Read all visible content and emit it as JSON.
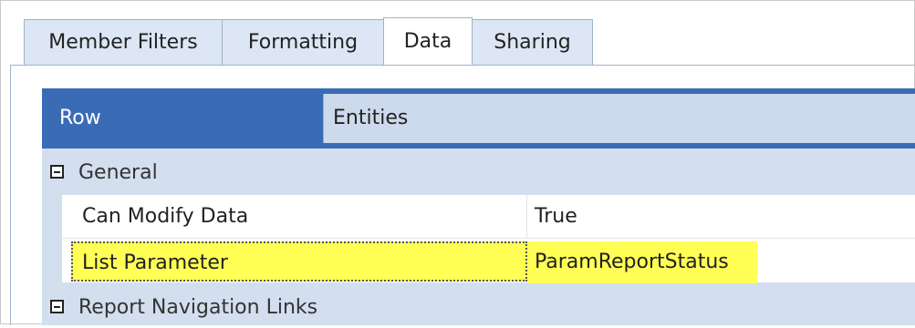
{
  "tabs": [
    {
      "label": "Member Filters",
      "active": false
    },
    {
      "label": "Formatting",
      "active": false
    },
    {
      "label": "Data",
      "active": true
    },
    {
      "label": "Sharing",
      "active": false
    }
  ],
  "grid": {
    "header": {
      "label": "Row",
      "value": "Entities"
    },
    "categories": [
      {
        "label": "General",
        "expanded": true,
        "properties": [
          {
            "name": "Can Modify Data",
            "value": "True",
            "highlighted": false
          },
          {
            "name": "List Parameter",
            "value": "ParamReportStatus",
            "highlighted": true
          }
        ]
      },
      {
        "label": "Report Navigation Links",
        "expanded": true,
        "properties": []
      }
    ]
  },
  "colors": {
    "header_bg": "#3a6bb5",
    "grid_bg": "#d3deef",
    "highlight": "#ffff55",
    "tab_bg": "#dce6f4"
  },
  "icons": {
    "collapse": "minus-box-icon"
  }
}
